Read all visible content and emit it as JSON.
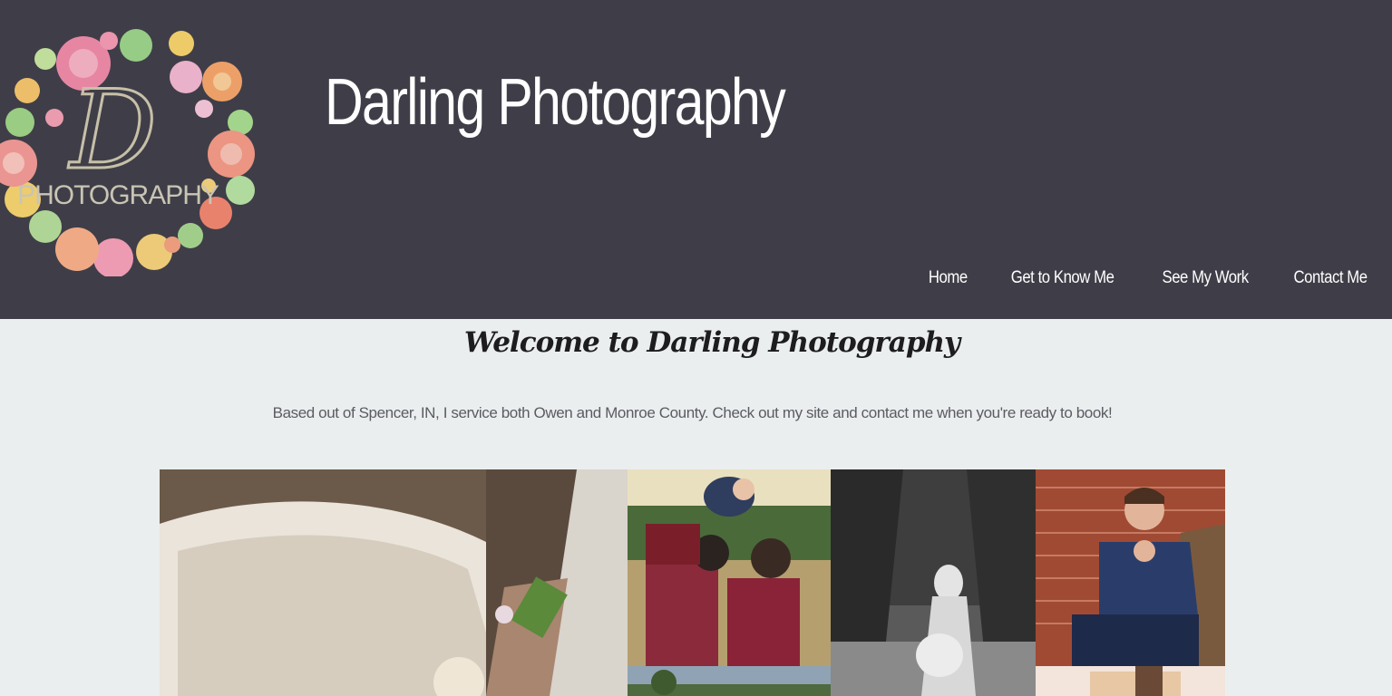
{
  "header": {
    "site_title": "Darling Photography",
    "logo": {
      "letter": "D",
      "text": "PHOTOGRAPHY"
    }
  },
  "nav": {
    "items": [
      {
        "label": "Home"
      },
      {
        "label": "Get to Know Me"
      },
      {
        "label": "See My Work"
      },
      {
        "label": "Contact Me"
      }
    ]
  },
  "main": {
    "welcome": "Welcome to Darling Photography",
    "intro": "Based out of Spencer, IN, I service both Owen and Monroe County. Check out my site and contact me when you're ready to book!"
  },
  "colors": {
    "header_bg": "#3f3e48",
    "page_bg": "#ebeeee",
    "title_text": "#ffffff"
  }
}
